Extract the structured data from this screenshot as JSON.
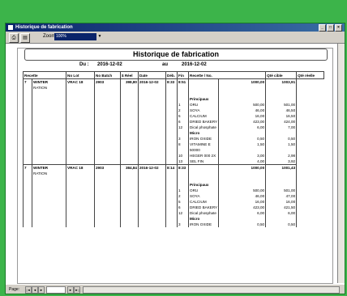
{
  "window": {
    "title": "Historique de fabrication"
  },
  "toolbar": {
    "zoom_label": "Zoom",
    "zoom_value": "100%"
  },
  "report": {
    "title": "Historique de fabrication",
    "from_label": "Du :",
    "from_date": "2016-12-02",
    "to_label": "au",
    "to_date": "2016-12-02"
  },
  "columns": [
    "Recette",
    "No Lot",
    "No Batch",
    "$ Réel",
    "Date",
    "Déb.",
    "Fin",
    "Recette / No.",
    "Qté cible",
    "Qté réelle"
  ],
  "rows": [
    {
      "kind": "main",
      "cells": [
        "7",
        "WINTER",
        "VRAC 18",
        "2903",
        "398,80",
        "2016-12-02",
        "8:33",
        "8:51",
        "",
        "1000,00",
        "1003,91"
      ]
    },
    {
      "kind": "sub",
      "cells": [
        "",
        "RATION",
        "",
        "",
        "",
        "",
        "",
        "",
        "",
        "",
        ""
      ]
    },
    {
      "kind": "blank",
      "cells": [
        "",
        "",
        "",
        "",
        "",
        "",
        "",
        "",
        "",
        "",
        ""
      ]
    },
    {
      "kind": "sec",
      "cells": [
        "",
        "",
        "",
        "",
        "",
        "",
        "",
        "",
        "Principaux",
        "",
        ""
      ]
    },
    {
      "kind": "ing",
      "cells": [
        "",
        "",
        "",
        "",
        "",
        "",
        "",
        "1",
        "ORU",
        "500,00",
        "501,00"
      ]
    },
    {
      "kind": "ing",
      "cells": [
        "",
        "",
        "",
        "",
        "",
        "",
        "",
        "2",
        "SOYA",
        "46,00",
        "46,50"
      ]
    },
    {
      "kind": "ing",
      "cells": [
        "",
        "",
        "",
        "",
        "",
        "",
        "",
        "5",
        "CALCIUM",
        "16,00",
        "16,50"
      ]
    },
    {
      "kind": "ing",
      "cells": [
        "",
        "",
        "",
        "",
        "",
        "",
        "",
        "6",
        "DRIED BAKERY",
        "423,00",
        "424,00"
      ]
    },
    {
      "kind": "ing",
      "cells": [
        "",
        "",
        "",
        "",
        "",
        "",
        "",
        "12",
        "Dical phosphate",
        "6,00",
        "7,00"
      ]
    },
    {
      "kind": "sec",
      "cells": [
        "",
        "",
        "",
        "",
        "",
        "",
        "",
        "",
        "Micro",
        "",
        ""
      ]
    },
    {
      "kind": "ing",
      "cells": [
        "",
        "",
        "",
        "",
        "",
        "",
        "",
        "3",
        "IRON OXIDE",
        "0,50",
        "0,50"
      ]
    },
    {
      "kind": "ing",
      "cells": [
        "",
        "",
        "",
        "",
        "",
        "",
        "",
        "8",
        "VITAMINE E",
        "1,50",
        "1,50"
      ]
    },
    {
      "kind": "ing",
      "cells": [
        "",
        "",
        "",
        "",
        "",
        "",
        "",
        "",
        "50000",
        "",
        ""
      ]
    },
    {
      "kind": "ing",
      "cells": [
        "",
        "",
        "",
        "",
        "",
        "",
        "",
        "10",
        "HEGER 000 2X",
        "3,00",
        "2,98"
      ]
    },
    {
      "kind": "ing",
      "cells": [
        "",
        "",
        "",
        "",
        "",
        "",
        "",
        "13",
        "SEL FIN",
        "4,00",
        "3,92"
      ]
    },
    {
      "kind": "main",
      "cells": [
        "7",
        "WINTER",
        "VRAC 18",
        "2903",
        "384,84",
        "2016-12-02",
        "8:14",
        "8:33",
        "",
        "1000,00",
        "1001,43"
      ]
    },
    {
      "kind": "sub",
      "cells": [
        "",
        "RATION",
        "",
        "",
        "",
        "",
        "",
        "",
        "",
        "",
        ""
      ]
    },
    {
      "kind": "blank",
      "cells": [
        "",
        "",
        "",
        "",
        "",
        "",
        "",
        "",
        "",
        "",
        ""
      ]
    },
    {
      "kind": "sec",
      "cells": [
        "",
        "",
        "",
        "",
        "",
        "",
        "",
        "",
        "Principaux",
        "",
        ""
      ]
    },
    {
      "kind": "ing",
      "cells": [
        "",
        "",
        "",
        "",
        "",
        "",
        "",
        "1",
        "ORU",
        "500,00",
        "501,00"
      ]
    },
    {
      "kind": "ing",
      "cells": [
        "",
        "",
        "",
        "",
        "",
        "",
        "",
        "2",
        "SOYA",
        "46,00",
        "47,00"
      ]
    },
    {
      "kind": "ing",
      "cells": [
        "",
        "",
        "",
        "",
        "",
        "",
        "",
        "5",
        "CALCIUM",
        "16,00",
        "16,00"
      ]
    },
    {
      "kind": "ing",
      "cells": [
        "",
        "",
        "",
        "",
        "",
        "",
        "",
        "6",
        "DRIED BAKERY",
        "423,00",
        "421,50"
      ]
    },
    {
      "kind": "ing",
      "cells": [
        "",
        "",
        "",
        "",
        "",
        "",
        "",
        "12",
        "Dical phosphate",
        "6,00",
        "6,00"
      ]
    },
    {
      "kind": "sec",
      "cells": [
        "",
        "",
        "",
        "",
        "",
        "",
        "",
        "",
        "Micro",
        "",
        ""
      ]
    },
    {
      "kind": "ing",
      "cells": [
        "",
        "",
        "",
        "",
        "",
        "",
        "",
        "3",
        "IRON OXIDE",
        "0,50",
        "0,50"
      ]
    }
  ],
  "status": {
    "page_label": "Page:"
  },
  "icons": {
    "print": "printer-icon",
    "export": "export-icon"
  }
}
